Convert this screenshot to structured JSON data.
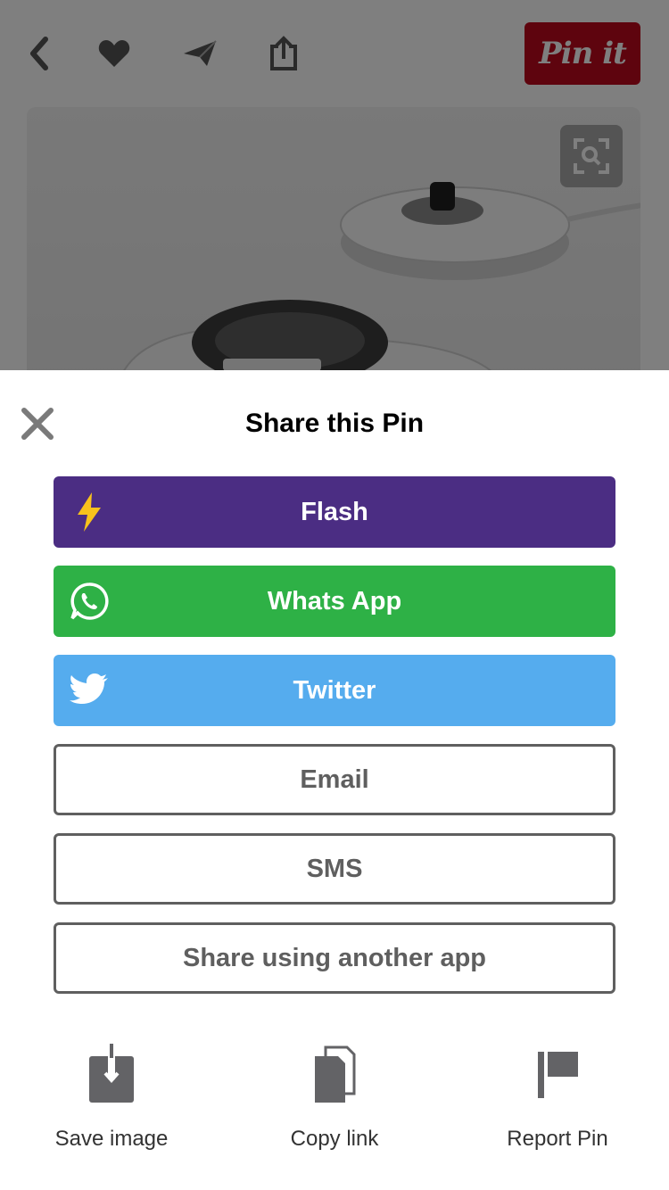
{
  "header": {
    "pin_it_label": "Pin it",
    "icons": [
      "back-icon",
      "heart-icon",
      "send-icon",
      "share-icon"
    ]
  },
  "sheet": {
    "title": "Share this Pin",
    "close_icon": "close-icon",
    "buttons": [
      {
        "label": "Flash",
        "icon": "lightning-icon",
        "color": "#4b2d83"
      },
      {
        "label": "Whats App",
        "icon": "whatsapp-icon",
        "color": "#2eb146"
      },
      {
        "label": "Twitter",
        "icon": "twitter-icon",
        "color": "#55acee"
      },
      {
        "label": "Email"
      },
      {
        "label": "SMS"
      },
      {
        "label": "Share using another app"
      }
    ],
    "actions": [
      {
        "label": "Save image",
        "icon": "download-icon"
      },
      {
        "label": "Copy link",
        "icon": "copy-icon"
      },
      {
        "label": "Report Pin",
        "icon": "flag-icon"
      }
    ]
  },
  "colors": {
    "pin_it": "#bd081c",
    "outline_text": "#5f5f5f"
  }
}
